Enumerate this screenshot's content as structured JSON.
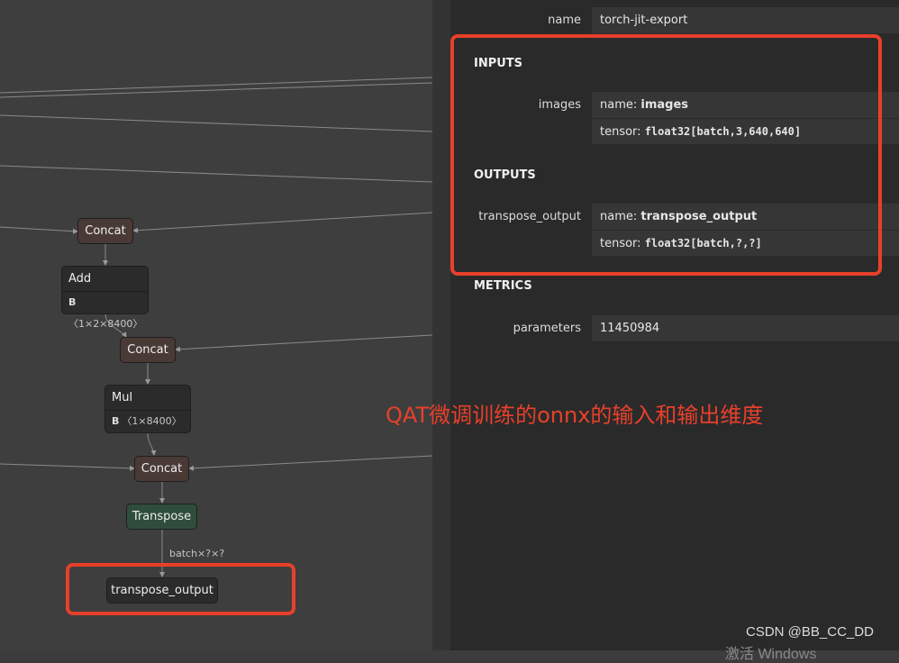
{
  "graph": {
    "nodes": {
      "concat1": "Concat",
      "add_title": "Add",
      "add_attr_name": "B",
      "add_attr_value": "〈1×2×8400〉",
      "concat2": "Concat",
      "mul_title": "Mul",
      "mul_attr_name": "B",
      "mul_attr_value": "〈1×8400〉",
      "concat3": "Concat",
      "transpose": "Transpose",
      "output": "transpose_output"
    },
    "edge_label": "batch×?×?"
  },
  "panel": {
    "name_label": "name",
    "name_value": "torch-jit-export",
    "inputs_header": "INPUTS",
    "input": {
      "label": "images",
      "name_prefix": "name: ",
      "name_value": "images",
      "tensor_prefix": "tensor: ",
      "tensor_value": "float32[batch,3,640,640]"
    },
    "outputs_header": "OUTPUTS",
    "output": {
      "label": "transpose_output",
      "name_prefix": "name: ",
      "name_value": "transpose_output",
      "tensor_prefix": "tensor: ",
      "tensor_value": "float32[batch,?,?]"
    },
    "metrics_header": "METRICS",
    "parameters_label": "parameters",
    "parameters_value": "11450984"
  },
  "annotation": "QAT微调训练的onnx的输入和输出维度",
  "watermark": "CSDN @BB_CC_DD",
  "watermark2": "激活 Windows",
  "colors": {
    "highlight": "#e8402b",
    "concat_fill": "#4a3a36",
    "transpose_fill": "#2f4d3c"
  }
}
